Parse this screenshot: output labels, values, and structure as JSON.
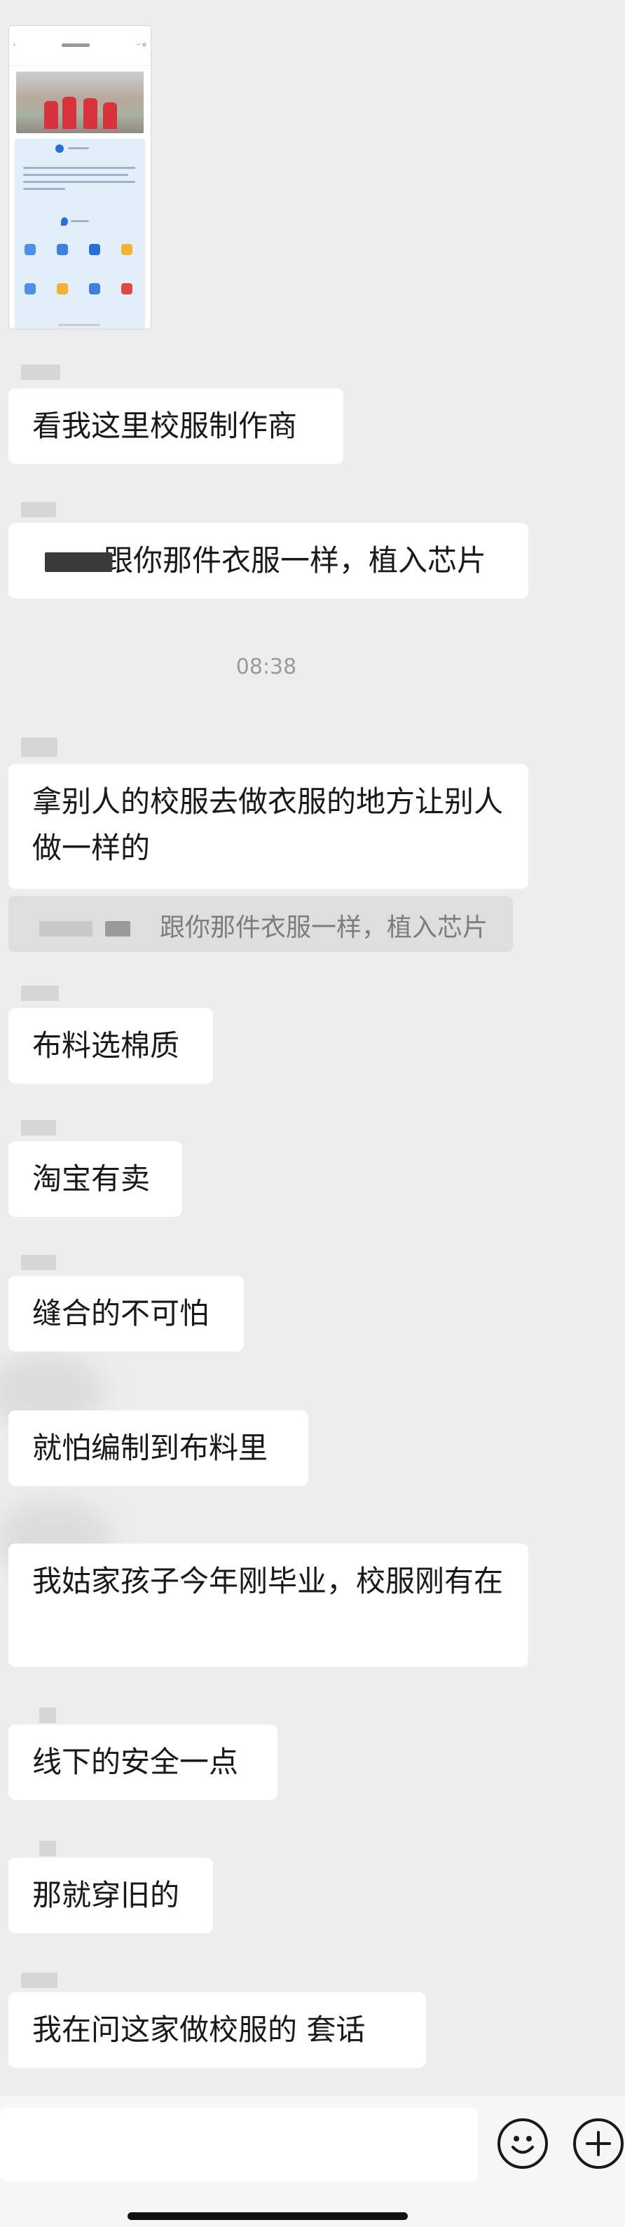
{
  "thumbnail": {
    "tabs": [
      "",
      "",
      "",
      "",
      ""
    ]
  },
  "chat": {
    "messages": [
      {
        "text": "看我这里校服制作商"
      },
      {
        "text": "跟你那件衣服一样，植入芯片"
      },
      {
        "text": "拿别人的校服去做衣服的地方让别人做一样的"
      },
      {
        "text": "布料选棉质"
      },
      {
        "text": "淘宝有卖"
      },
      {
        "text": "缝合的不可怕"
      },
      {
        "text": "就怕编制到布料里"
      },
      {
        "text": "我姑家孩子今年刚毕业，校服刚有在"
      },
      {
        "text": "线下的安全一点"
      },
      {
        "text": "那就穿旧的"
      },
      {
        "text": "我在问这家做校服的  套话"
      }
    ],
    "timestamp": "08:38",
    "quote_text": "跟你那件衣服一样，植入芯片"
  },
  "input_bar": {
    "emoji_icon": "smiley-face-icon",
    "plus_icon": "plus-circle-icon"
  },
  "colors": {
    "background": "#ededed",
    "bubble": "#ffffff",
    "text": "#191919",
    "timestamp": "#9a9a9a",
    "quote_background": "#dedede"
  }
}
